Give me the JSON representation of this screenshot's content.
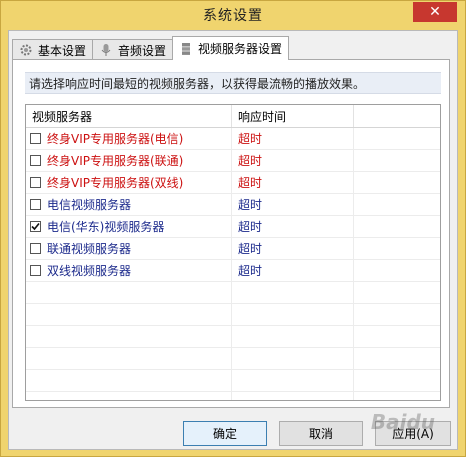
{
  "window": {
    "title": "系统设置",
    "close_label": "✕"
  },
  "tabs": [
    {
      "label": "基本设置",
      "icon": "gear-icon"
    },
    {
      "label": "音频设置",
      "icon": "microphone-icon"
    },
    {
      "label": "视频服务器设置",
      "icon": "server-icon"
    }
  ],
  "panel": {
    "description": "请选择响应时间最短的视频服务器，以获得最流畅的播放效果。",
    "columns": [
      "视频服务器",
      "响应时间"
    ],
    "rows": [
      {
        "name": "终身VIP专用服务器(电信)",
        "response": "超时",
        "checked": false,
        "color": "#cc1111"
      },
      {
        "name": "终身VIP专用服务器(联通)",
        "response": "超时",
        "checked": false,
        "color": "#cc1111"
      },
      {
        "name": "终身VIP专用服务器(双线)",
        "response": "超时",
        "checked": false,
        "color": "#cc1111"
      },
      {
        "name": "电信视频服务器",
        "response": "超时",
        "checked": false,
        "color": "#1c2a8c"
      },
      {
        "name": "电信(华东)视频服务器",
        "response": "超时",
        "checked": true,
        "color": "#1c2a8c"
      },
      {
        "name": "联通视频服务器",
        "response": "超时",
        "checked": false,
        "color": "#1c2a8c"
      },
      {
        "name": "双线视频服务器",
        "response": "超时",
        "checked": false,
        "color": "#1c2a8c"
      }
    ]
  },
  "buttons": {
    "ok": "确定",
    "cancel": "取消",
    "apply": "应用(A)"
  },
  "watermark": "Baidu"
}
